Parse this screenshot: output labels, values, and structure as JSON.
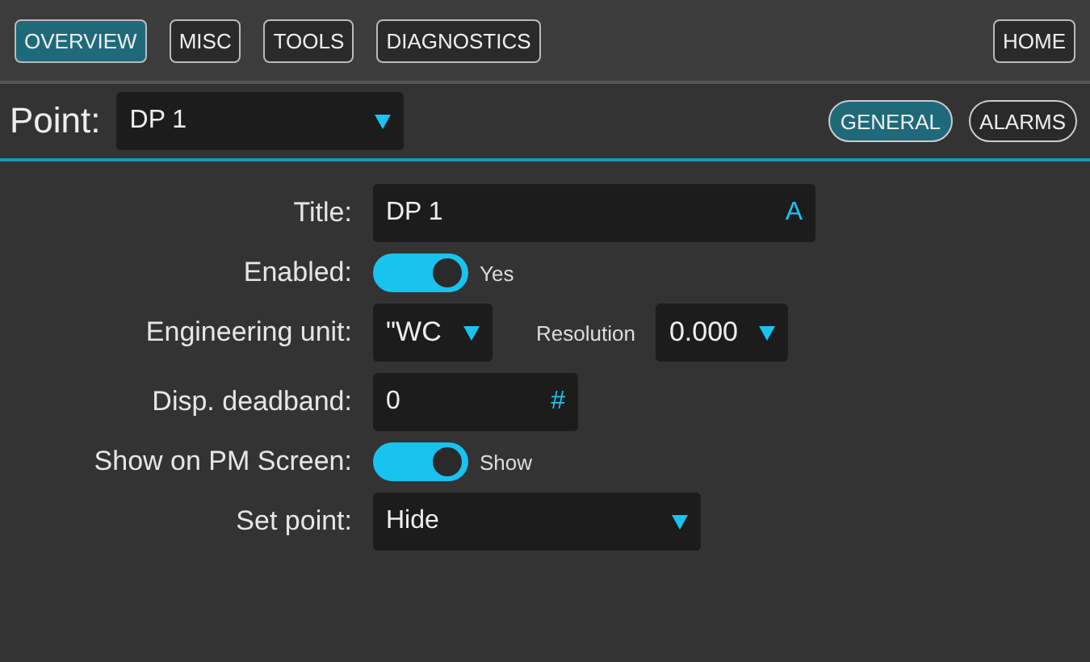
{
  "nav": [
    {
      "label": "OVERVIEW",
      "selected": true
    },
    {
      "label": "MISC",
      "selected": false
    },
    {
      "label": "TOOLS",
      "selected": false
    },
    {
      "label": "DIAGNOSTICS",
      "selected": false
    }
  ],
  "home": {
    "label": "HOME"
  },
  "point": {
    "label": "Point:",
    "value": "DP 1"
  },
  "sections": [
    {
      "label": "GENERAL",
      "selected": true
    },
    {
      "label": "ALARMS",
      "selected": false
    }
  ],
  "fields": [
    {
      "kind": "text",
      "label": "Title:",
      "value": "DP 1",
      "glyph": "A"
    },
    {
      "kind": "toggle",
      "label": "Enabled:",
      "on": true,
      "caption": "Yes"
    },
    {
      "kind": "unit",
      "label": "Engineering unit:",
      "value": "\"WC",
      "secondary": {
        "label": "Resolution",
        "value": "0.000"
      }
    },
    {
      "kind": "number",
      "label": "Disp. deadband:",
      "value": "0",
      "glyph": "#"
    },
    {
      "kind": "toggle",
      "label": "Show on PM Screen:",
      "on": true,
      "caption": "Show"
    },
    {
      "kind": "select",
      "label": "Set point:",
      "value": "Hide"
    }
  ]
}
